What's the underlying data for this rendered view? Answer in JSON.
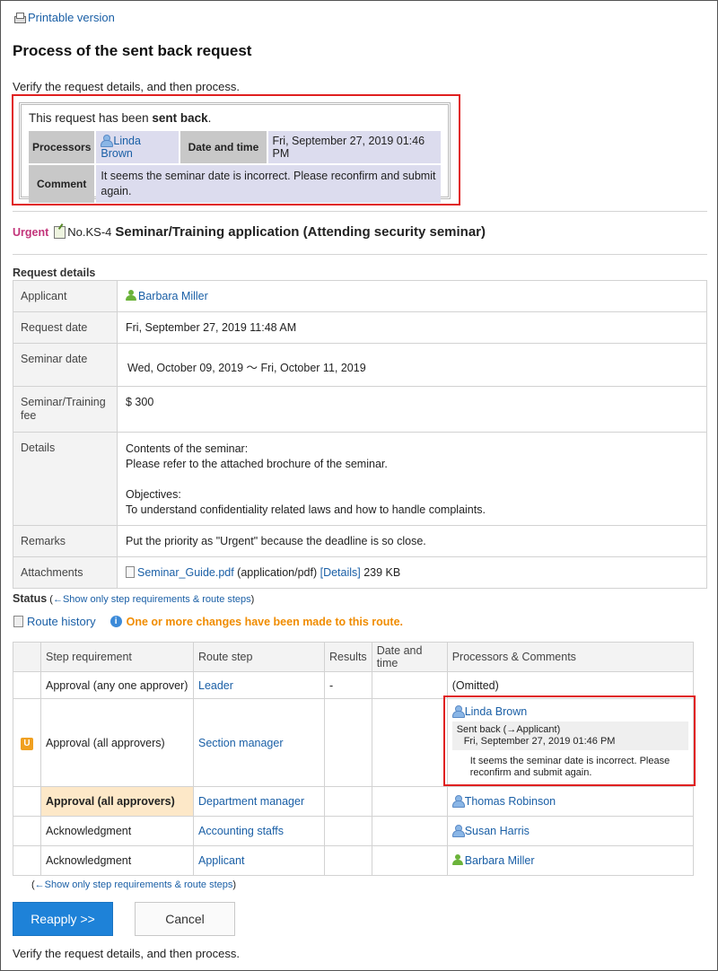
{
  "header": {
    "printable_label": "Printable version",
    "page_title": "Process of the sent back request",
    "verify_text": "Verify the request details, and then process."
  },
  "sent_back_box": {
    "message_prefix": "This request has been ",
    "message_bold": "sent back",
    "message_suffix": ".",
    "processors_label": "Processors",
    "processor_name": "Linda Brown",
    "date_label": "Date and time",
    "date_value": "Fri, September 27, 2019 01:46 PM",
    "comment_label": "Comment",
    "comment_value": "It seems the seminar date is incorrect. Please reconfirm and submit again."
  },
  "request": {
    "urgent_label": "Urgent",
    "number": "No.KS-4",
    "title": "Seminar/Training application (Attending security seminar)"
  },
  "details": {
    "section_label": "Request details",
    "rows": {
      "applicant": {
        "label": "Applicant",
        "value": "Barbara Miller"
      },
      "request_date": {
        "label": "Request date",
        "value": "Fri, September 27, 2019 11:48 AM"
      },
      "seminar_date": {
        "label": "Seminar date",
        "value": "Wed, October 09, 2019 ～ Fri, October 11, 2019"
      },
      "fee": {
        "label": "Seminar/Training fee",
        "value": "$ 300"
      },
      "details": {
        "label": "Details",
        "line1": "Contents of the seminar:",
        "line2": "Please refer to the attached brochure of the seminar.",
        "line3": "Objectives:",
        "line4": "To understand confidentiality related laws and how to handle complaints."
      },
      "remarks": {
        "label": "Remarks",
        "value": "Put the priority as \"Urgent\" because the deadline is so close."
      },
      "attachments": {
        "label": "Attachments",
        "file_name": "Seminar_Guide.pdf",
        "file_type": " (application/pdf) ",
        "details_link": "[Details]",
        "file_size": " 239 KB"
      }
    }
  },
  "status": {
    "label": "Status",
    "toggle_link_prefix": " (",
    "toggle_link": "←Show only step requirements & route steps",
    "toggle_link_suffix": ")",
    "route_history": "Route history",
    "info_glyph": "i",
    "changes_notice": "One or more changes have been made to this route."
  },
  "route": {
    "headers": {
      "step_requirement": "Step requirement",
      "route_step": "Route step",
      "results": "Results",
      "date_time": "Date and time",
      "processors": "Processors & Comments"
    },
    "rows": {
      "r1": {
        "requirement": "Approval (any one approver)",
        "step": "Leader",
        "result": "-",
        "processor": "(Omitted)"
      },
      "r2": {
        "badge": "U",
        "requirement": "Approval (all approvers)",
        "step": "Section manager",
        "processor": "Linda Brown",
        "action": "Sent back (→Applicant)",
        "action_date": "Fri, September 27, 2019 01:46 PM",
        "comment": "It seems the seminar date is incorrect. Please reconfirm and submit again."
      },
      "r3": {
        "requirement": "Approval (all approvers)",
        "step": "Department manager",
        "processor": "Thomas Robinson"
      },
      "r4": {
        "requirement": "Acknowledgment",
        "step": "Accounting staffs",
        "processor": "Susan Harris"
      },
      "r5": {
        "requirement": "Acknowledgment",
        "step": "Applicant",
        "processor": "Barbara Miller"
      }
    },
    "bottom_link_prefix": "(",
    "bottom_link": "←Show only step requirements & route steps",
    "bottom_link_suffix": ")"
  },
  "actions": {
    "reapply_label": "Reapply >>",
    "cancel_label": "Cancel",
    "verify_text": "Verify the request details, and then process."
  },
  "colors": {
    "link": "#1a5fa6",
    "urgent": "#c2347a",
    "notice": "#f08c00",
    "primary_button": "#1e82d8",
    "highlight_border": "#e02020",
    "current_step": "#fde8c8"
  }
}
